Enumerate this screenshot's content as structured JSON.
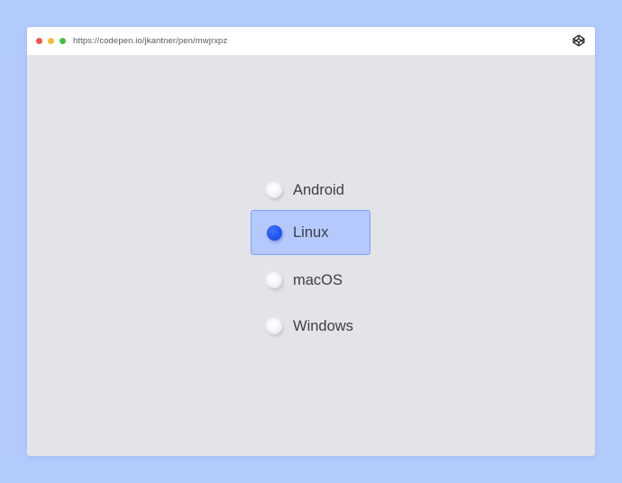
{
  "browser": {
    "url": "https://codepen.io/jkantner/pen/mwjrxpz",
    "window_controls": [
      "close",
      "minimize",
      "maximize"
    ],
    "brand_icon": "codepen-icon"
  },
  "radio_group": {
    "options": [
      {
        "label": "Android",
        "checked": false
      },
      {
        "label": "Linux",
        "checked": true
      },
      {
        "label": "macOS",
        "checked": false
      },
      {
        "label": "Windows",
        "checked": false
      }
    ],
    "selected": "Linux"
  },
  "colors": {
    "page_background": "#b3cbfb",
    "window_background": "#e3e4e8",
    "selected_background": "#b6c9fd",
    "selected_border": "#7ea0fb",
    "accent": "#2357f2"
  }
}
